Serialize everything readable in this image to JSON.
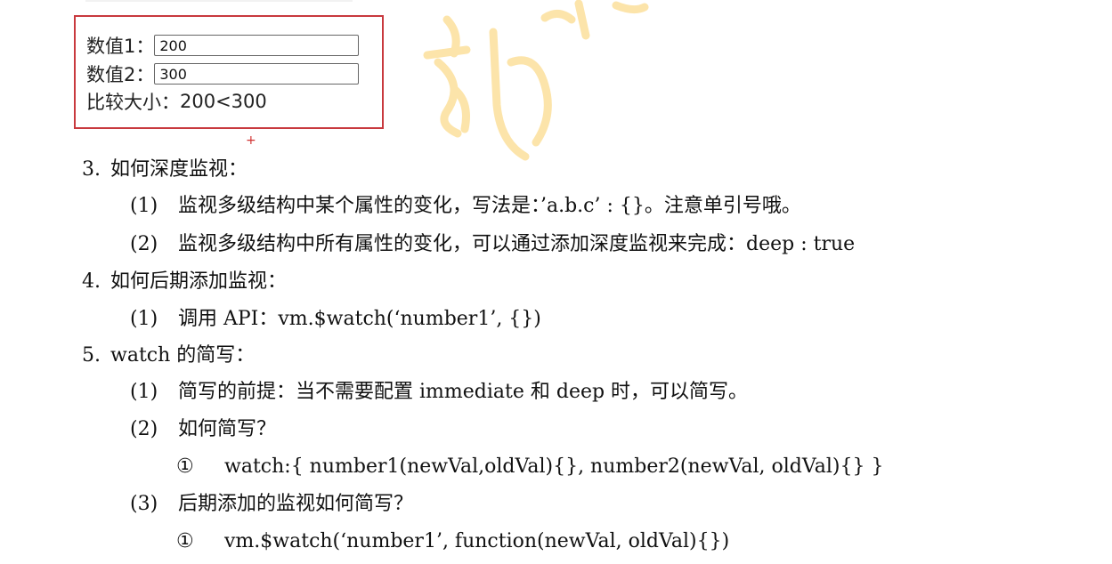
{
  "demo": {
    "label1": "数值1：",
    "value1": "200",
    "label2": "数值2：",
    "value2": "300",
    "compare_label": "比较大小：",
    "compare_result": "200<300"
  },
  "marker": "+",
  "colors": {
    "box_border": "#c8393e",
    "watermark": "#fce3a6"
  },
  "content": [
    {
      "num": "3.",
      "text": "如何深度监视："
    },
    {
      "num": "(1)",
      "text": "监视多级结构中某个属性的变化，写法是：’a.b.c’ : {}。注意单引号哦。"
    },
    {
      "num": "(2)",
      "text": "监视多级结构中所有属性的变化，可以通过添加深度监视来完成：deep : true"
    },
    {
      "num": "4.",
      "text": "如何后期添加监视："
    },
    {
      "num": "(1)",
      "text": "调用 API：vm.$watch(‘number1’, {})"
    },
    {
      "num": "5.",
      "text": "watch 的简写："
    },
    {
      "num": "(1)",
      "text": "简写的前提：当不需要配置 immediate 和 deep 时，可以简写。"
    },
    {
      "num": "(2)",
      "text": "如何简写？"
    },
    {
      "num": "①",
      "text": "watch:{ number1(newVal,oldVal){}, number2(newVal, oldVal){} }"
    },
    {
      "num": "(3)",
      "text": "后期添加的监视如何简写？"
    },
    {
      "num": "①",
      "text": "vm.$watch(‘number1’, function(newVal, oldVal){})"
    }
  ]
}
